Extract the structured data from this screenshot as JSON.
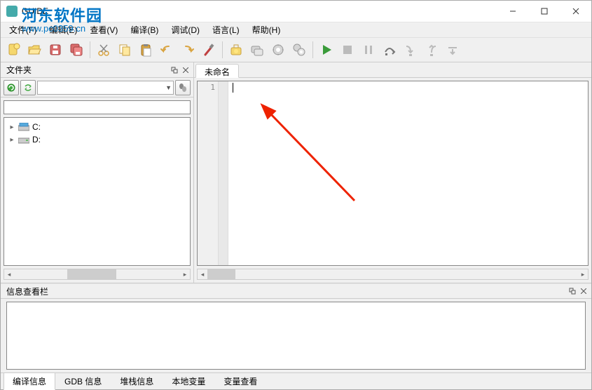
{
  "window": {
    "title": "GUIDE"
  },
  "watermark": {
    "line1": "河东软件园",
    "line2": "www.pc0359.cn"
  },
  "menu": {
    "file": "文件(F)",
    "edit": "编辑(E)",
    "view": "查看(V)",
    "compile": "编译(B)",
    "debug": "调试(D)",
    "language": "语言(L)",
    "help": "帮助(H)"
  },
  "panel": {
    "folder_title": "文件夹",
    "info_title": "信息查看栏"
  },
  "drives": [
    {
      "label": "C:"
    },
    {
      "label": "D:"
    }
  ],
  "editor": {
    "tab_name": "未命名",
    "line_numbers": [
      "1"
    ]
  },
  "bottom_tabs": {
    "compile_info": "编译信息",
    "gdb_info": "GDB 信息",
    "stack_info": "堆栈信息",
    "local_var": "本地变量",
    "var_watch": "变量查看"
  },
  "icons": {
    "new": "new-file",
    "open": "open-folder",
    "save": "save",
    "saveall": "save-all",
    "cut": "cut",
    "copy": "copy",
    "paste": "paste",
    "undo": "undo",
    "redo": "redo",
    "settings": "settings",
    "compile": "compile",
    "compileall": "compile-all",
    "build": "build",
    "buildall": "build-all",
    "run": "run",
    "stop": "stop",
    "pause": "pause",
    "stepover": "step-over",
    "stepinto": "step-into",
    "stepout": "step-out",
    "stepline": "step-line"
  }
}
